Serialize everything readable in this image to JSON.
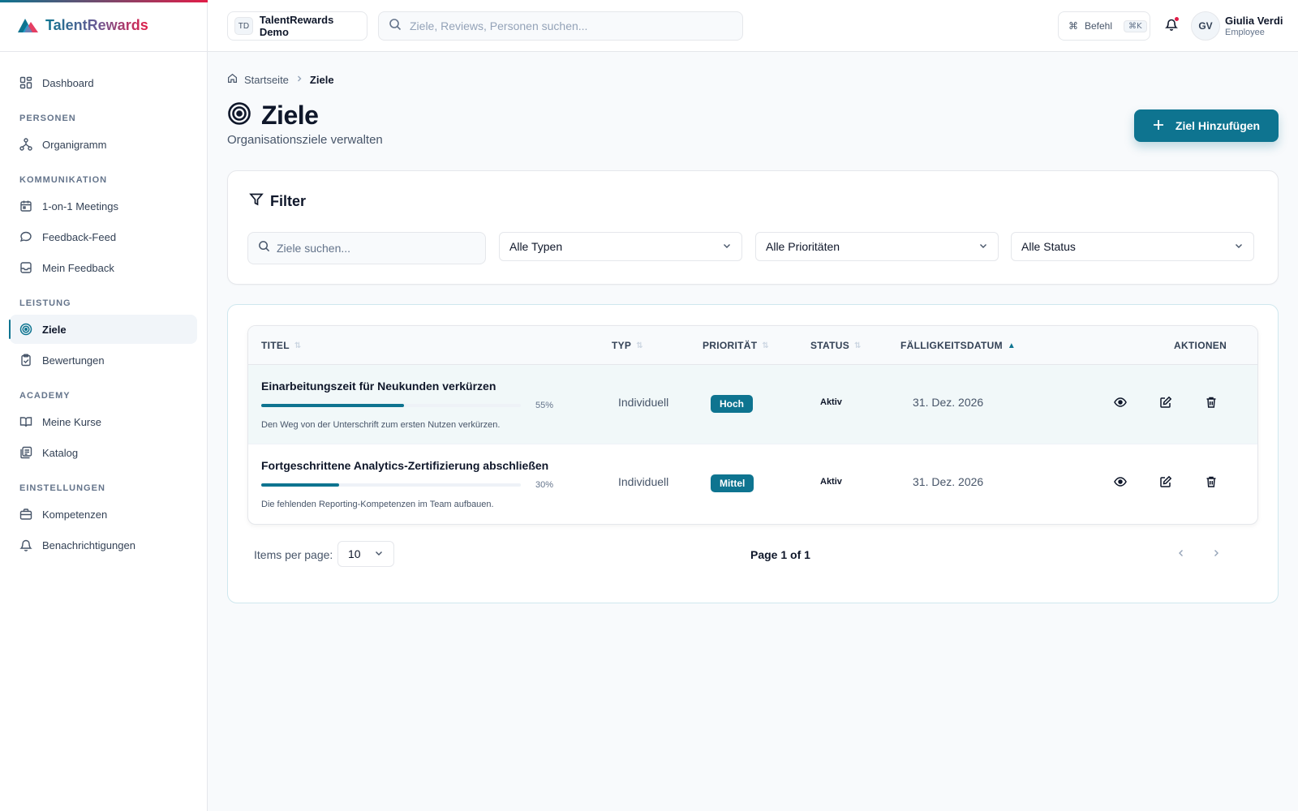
{
  "app": {
    "name": "TalentRewards"
  },
  "colors": {
    "primary": "#0e7490",
    "accent": "#e11d48"
  },
  "sidebar": {
    "items": [
      {
        "label": "Dashboard",
        "icon": "dashboard-icon"
      },
      {
        "section": "PERSONEN"
      },
      {
        "label": "Organigramm",
        "icon": "org-chart-icon"
      },
      {
        "section": "KOMMUNIKATION"
      },
      {
        "label": "1-on-1 Meetings",
        "icon": "calendar-icon"
      },
      {
        "label": "Feedback-Feed",
        "icon": "chat-bubble-icon"
      },
      {
        "label": "Mein Feedback",
        "icon": "inbox-icon"
      },
      {
        "section": "LEISTUNG"
      },
      {
        "label": "Ziele",
        "icon": "target-icon",
        "active": true
      },
      {
        "label": "Bewertungen",
        "icon": "clipboard-check-icon"
      },
      {
        "section": "ACADEMY"
      },
      {
        "label": "Meine Kurse",
        "icon": "book-open-icon"
      },
      {
        "label": "Katalog",
        "icon": "library-icon"
      },
      {
        "section": "EINSTELLUNGEN"
      },
      {
        "label": "Kompetenzen",
        "icon": "briefcase-icon"
      },
      {
        "label": "Benachrichtigungen",
        "icon": "bell-icon"
      }
    ]
  },
  "topbar": {
    "workspace_badge": "TD",
    "workspace_name": "TalentRewards Demo",
    "search_placeholder": "Ziele, Reviews, Personen suchen...",
    "command_label": "Befehl",
    "command_shortcut": "⌘K",
    "user_initials": "GV",
    "user_name": "Giulia Verdi",
    "user_role": "Employee"
  },
  "breadcrumb": {
    "home": "Startseite",
    "current": "Ziele"
  },
  "page": {
    "title": "Ziele",
    "subtitle": "Organisationsziele verwalten",
    "add_button": "Ziel Hinzufügen"
  },
  "filter": {
    "title": "Filter",
    "search_placeholder": "Ziele suchen...",
    "type_select": "Alle Typen",
    "priority_select": "Alle Prioritäten",
    "status_select": "Alle Status"
  },
  "table": {
    "columns": {
      "title": "TITEL",
      "type": "TYP",
      "priority": "PRIORITÄT",
      "status": "STATUS",
      "due_date": "FÄLLIGKEITSDATUM",
      "actions": "AKTIONEN"
    },
    "rows": [
      {
        "title": "Einarbeitungszeit für Neukunden verkürzen",
        "progress": 55,
        "progress_label": "55%",
        "description": "Den Weg von der Unterschrift zum ersten Nutzen verkürzen.",
        "type": "Individuell",
        "priority": "Hoch",
        "status": "Aktiv",
        "due_date": "31. Dez. 2026"
      },
      {
        "title": "Fortgeschrittene Analytics-Zertifizierung abschließen",
        "progress": 30,
        "progress_label": "30%",
        "description": "Die fehlenden Reporting-Kompetenzen im Team aufbauen.",
        "type": "Individuell",
        "priority": "Mittel",
        "status": "Aktiv",
        "due_date": "31. Dez. 2026"
      }
    ]
  },
  "pagination": {
    "items_per_page_label": "Items per page:",
    "items_per_page": "10",
    "page_info": "Page 1 of 1"
  }
}
